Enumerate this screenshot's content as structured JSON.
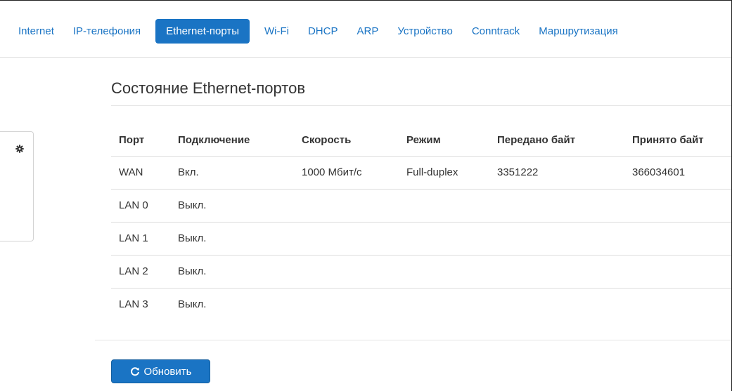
{
  "nav": {
    "tabs": [
      {
        "label": "Internet"
      },
      {
        "label": "IP-телефония"
      },
      {
        "label": "Ethernet-порты",
        "active": true
      },
      {
        "label": "Wi-Fi"
      },
      {
        "label": "DHCP"
      },
      {
        "label": "ARP"
      },
      {
        "label": "Устройство"
      },
      {
        "label": "Conntrack"
      },
      {
        "label": "Маршрутизация"
      }
    ]
  },
  "side": {
    "icon": "gear-icon"
  },
  "main": {
    "title": "Состояние Ethernet-портов",
    "table": {
      "headers": [
        "Порт",
        "Подключение",
        "Скорость",
        "Режим",
        "Передано байт",
        "Принято байт"
      ],
      "rows": [
        [
          "WAN",
          "Вкл.",
          "1000 Мбит/с",
          "Full-duplex",
          "3351222",
          "366034601"
        ],
        [
          "LAN 0",
          "Выкл.",
          "",
          "",
          "",
          ""
        ],
        [
          "LAN 1",
          "Выкл.",
          "",
          "",
          "",
          ""
        ],
        [
          "LAN 2",
          "Выкл.",
          "",
          "",
          "",
          ""
        ],
        [
          "LAN 3",
          "Выкл.",
          "",
          "",
          "",
          ""
        ]
      ]
    },
    "refresh_label": "Обновить"
  },
  "colors": {
    "accent": "#1a74c4",
    "border": "#dddddd"
  }
}
